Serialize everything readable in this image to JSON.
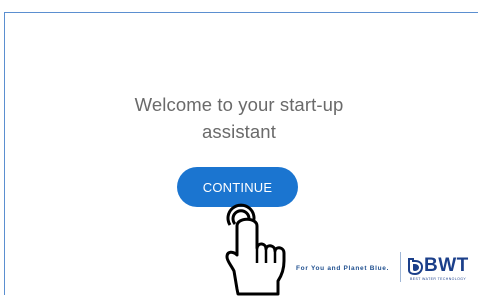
{
  "welcome": {
    "line1": "Welcome to your start-up",
    "line2": "assistant"
  },
  "continue_button": {
    "label": "CONTINUE"
  },
  "branding": {
    "tagline": "For You and Planet Blue.",
    "logo_text": "BWT",
    "logo_subtext": "BEST WATER TECHNOLOGY"
  },
  "icons": {
    "cursor": "hand-pointer-icon",
    "logo": "bwt-drop-icon"
  },
  "colors": {
    "accent": "#1b75d0",
    "brand": "#1b3f8a",
    "title_text": "#6a6a6a"
  }
}
